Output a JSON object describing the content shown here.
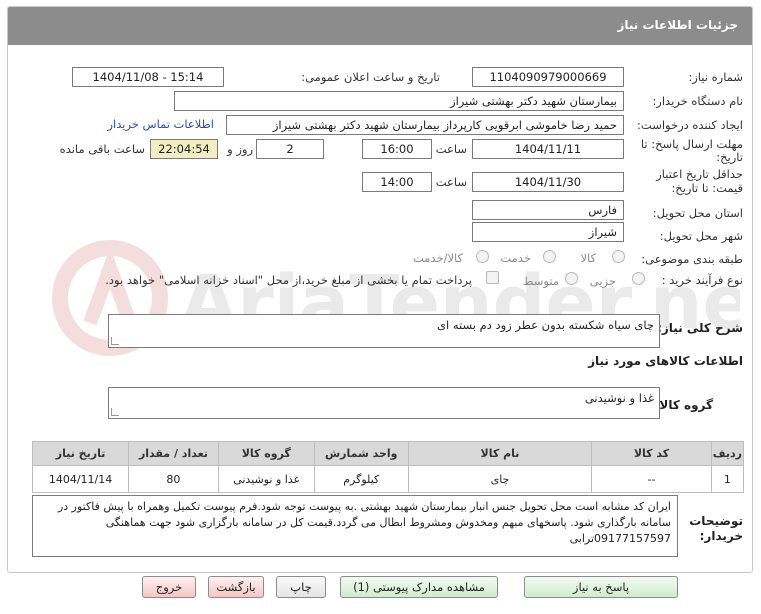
{
  "header": {
    "title": "جزئیات اطلاعات نیاز"
  },
  "watermark": {
    "text": "AriaTender.net"
  },
  "need_number": {
    "label": "شماره نیاز:",
    "value": "1104090979000669"
  },
  "announce_datetime": {
    "label": "تاریخ و ساعت اعلان عمومی:",
    "value": "1404/11/08 - 15:14"
  },
  "buyer_org": {
    "label": "نام دستگاه خریدار:",
    "value": "بیمارستان شهید دکتر بهشتی شیراز"
  },
  "requester": {
    "label": "ایجاد کننده درخواست:",
    "value": "حمید رضا خاموشی ابرقویی کارپرداز بیمارستان شهید دکتر بهشتی شیراز",
    "contact_link": "اطلاعات تماس خریدار"
  },
  "reply_deadline": {
    "label_line1": "مهلت ارسال پاسخ: تا",
    "label_line2": "تاریخ:",
    "date": "1404/11/11",
    "time_label": "ساعت",
    "time": "16:00",
    "days": "2",
    "days_label": "روز و",
    "remaining": "22:04:54",
    "remaining_label": "ساعت باقی مانده"
  },
  "price_validity": {
    "label_line1": "حداقل تاریخ اعتبار",
    "label_line2": "قیمت: تا تاریخ:",
    "date": "1404/11/30",
    "time_label": "ساعت",
    "time": "14:00"
  },
  "province": {
    "label": "استان محل تحویل:",
    "value": "فارس"
  },
  "city": {
    "label": "شهر محل تحویل:",
    "value": "شیراز"
  },
  "category": {
    "label": "طبقه بندی موضوعی:",
    "options": [
      "کالا",
      "خدمت",
      "کالا/خدمت"
    ]
  },
  "purchase_process": {
    "label": "نوع فرآیند خرید :",
    "options": [
      "جزیی",
      "متوسط"
    ],
    "treasury_text": "پرداخت تمام یا بخشی از مبلغ خرید،از محل \"اسناد خزانه اسلامی\" خواهد بود."
  },
  "general_desc": {
    "label": "شرح کلی نیاز:",
    "value": "چای سیاه شکسته بدون عطر زود دم بسته ای"
  },
  "goods_info": {
    "title": "اطلاعات کالاهای مورد نیاز"
  },
  "goods_group": {
    "label": "گروه کالا:",
    "value": "غذا و نوشیدنی"
  },
  "table": {
    "headers": [
      "ردیف",
      "کد کالا",
      "نام کالا",
      "واحد شمارش",
      "گروه کالا",
      "تعداد / مقدار",
      "تاریخ نیاز"
    ],
    "rows": [
      [
        "1",
        "--",
        "چای",
        "کیلوگرم",
        "غذا و نوشیدنی",
        "80",
        "1404/11/14"
      ]
    ]
  },
  "buyer_notes": {
    "label_line1": "توضیحات",
    "label_line2": "خریدار:",
    "value": "ایران کد مشابه است محل تحویل جنس انبار بیمارستان شهید بهشتی .به پیوست توجه شود.فرم پیوست تکمیل وهمراه با پیش فاکتور در سامانه بارگذاری شود. پاسخهای مبهم ومخدوش ومشروط ابطال می گردد.قیمت کل در سامانه بارگزاری شود جهت هماهنگی 09177157597ترابی"
  },
  "buttons": {
    "reply": "پاسخ به نیاز",
    "attachments": "مشاهده مدارک پیوستی (1)",
    "print": "چاپ",
    "back": "بازگشت",
    "exit": "خروج"
  }
}
